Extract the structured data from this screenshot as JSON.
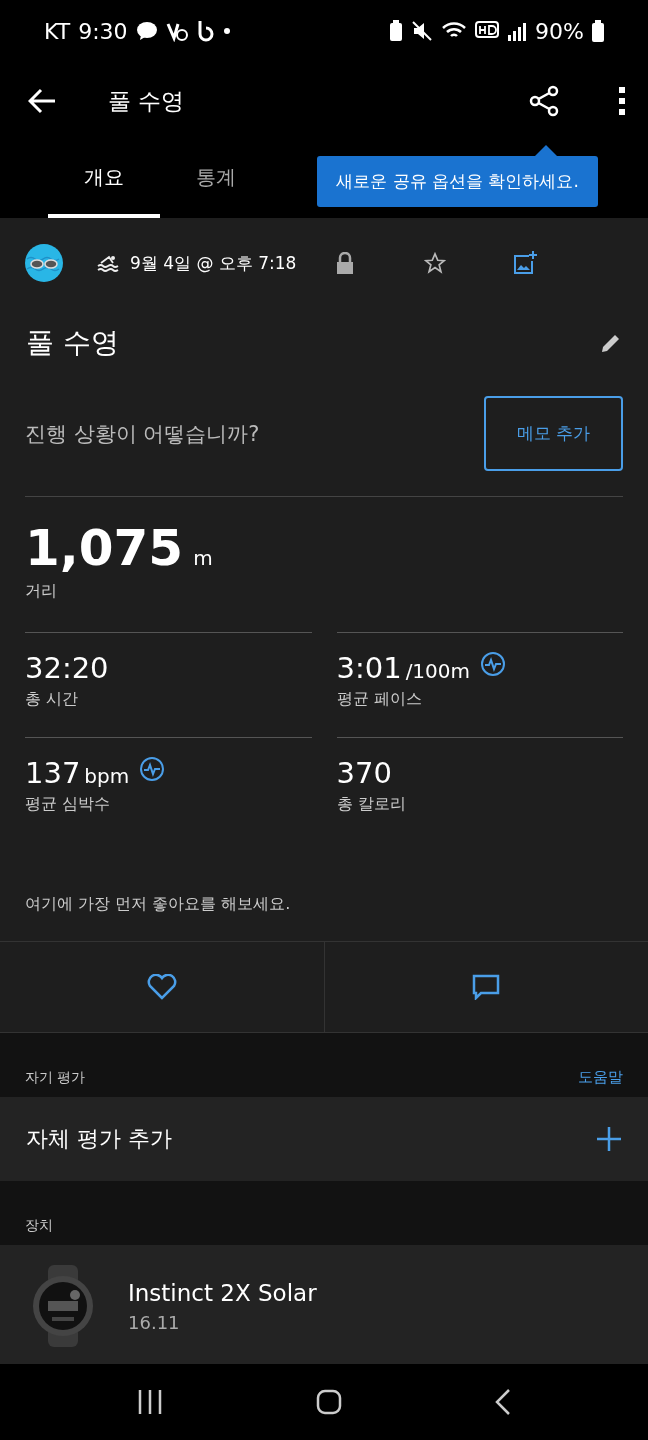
{
  "status_bar": {
    "carrier": "KT",
    "time": "9:30",
    "battery": "90%"
  },
  "app_bar": {
    "title": "풀 수영"
  },
  "tabs": [
    {
      "label": "개요",
      "selected": true
    },
    {
      "label": "통계",
      "selected": false
    }
  ],
  "tooltip": "새로운 공유 옵션을 확인하세요.",
  "activity": {
    "date": "9월 4일 @ 오후 7:18",
    "title": "풀 수영",
    "prompt": "진행 상황이 어떻습니까?",
    "note_button": "메모 추가"
  },
  "distance": {
    "value": "1,075",
    "unit": "m",
    "label": "거리"
  },
  "stats": [
    {
      "value": "32:20",
      "label": "총 시간",
      "kind": "plain"
    },
    {
      "value": "3:01",
      "unit": "/100m",
      "label": "평균 페이스",
      "kind": "graph"
    },
    {
      "value": "137",
      "unit": "bpm",
      "label": "평균 심박수",
      "kind": "graph"
    },
    {
      "value": "370",
      "label": "총 칼로리",
      "kind": "plain"
    }
  ],
  "like_prompt": "여기에 가장 먼저 좋아요를 해보세요.",
  "self_eval": {
    "section": "자기 평가",
    "help": "도움말",
    "add": "자체 평가 추가"
  },
  "device": {
    "section": "장치",
    "name": "Instinct 2X Solar",
    "version": "16.11"
  }
}
